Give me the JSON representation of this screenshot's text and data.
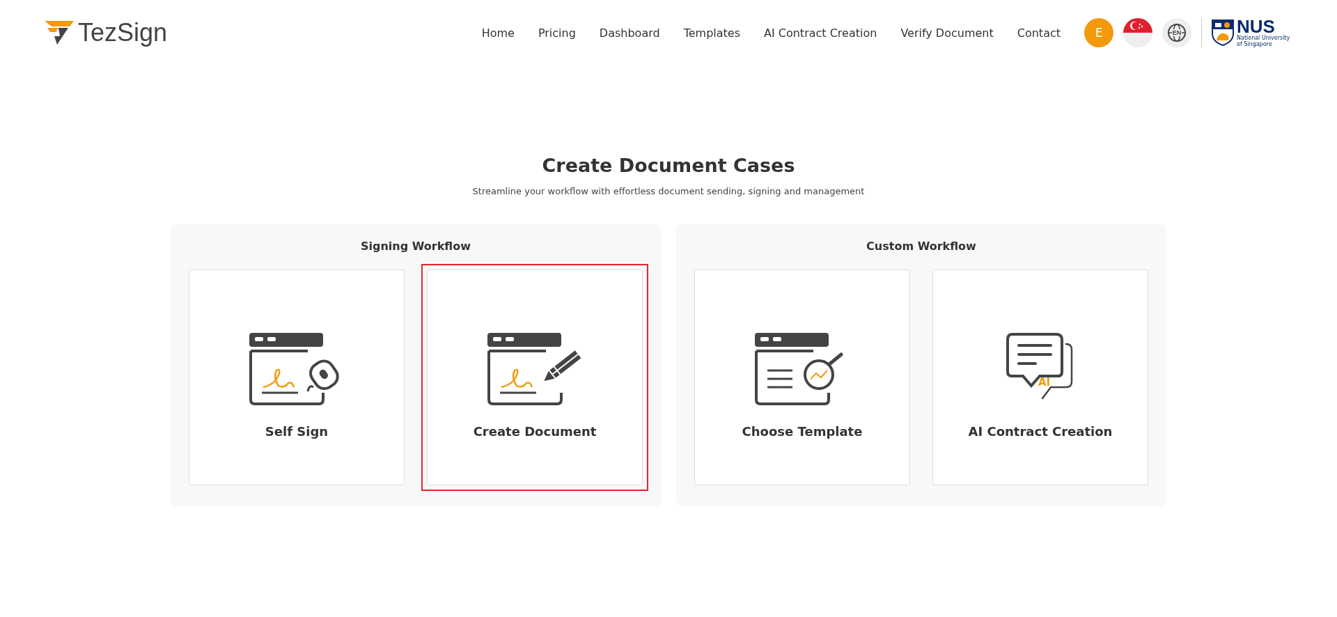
{
  "header": {
    "logo": {
      "text": "TezSign"
    },
    "nav": [
      {
        "label": "Home"
      },
      {
        "label": "Pricing"
      },
      {
        "label": "Dashboard"
      },
      {
        "label": "Templates"
      },
      {
        "label": "AI Contract Creation"
      },
      {
        "label": "Verify Document"
      },
      {
        "label": "Contact"
      }
    ],
    "avatar": {
      "initial": "E"
    },
    "language": {
      "code": "EN"
    },
    "partner": {
      "name": "NUS",
      "subtitle": "National University of Singapore"
    }
  },
  "main": {
    "title": "Create Document Cases",
    "subtitle": "Streamline your workflow with effortless document sending, signing and management",
    "groups": [
      {
        "title": "Signing Workflow",
        "cards": [
          {
            "kind": "self-sign",
            "label": "Self Sign",
            "selected": false
          },
          {
            "kind": "create-document",
            "label": "Create Document",
            "selected": true
          }
        ]
      },
      {
        "title": "Custom Workflow",
        "cards": [
          {
            "kind": "template",
            "label": "Choose Template",
            "selected": false
          },
          {
            "kind": "ai-chat",
            "label": "AI Contract Creation",
            "badge": "AI",
            "selected": false
          }
        ]
      }
    ]
  }
}
